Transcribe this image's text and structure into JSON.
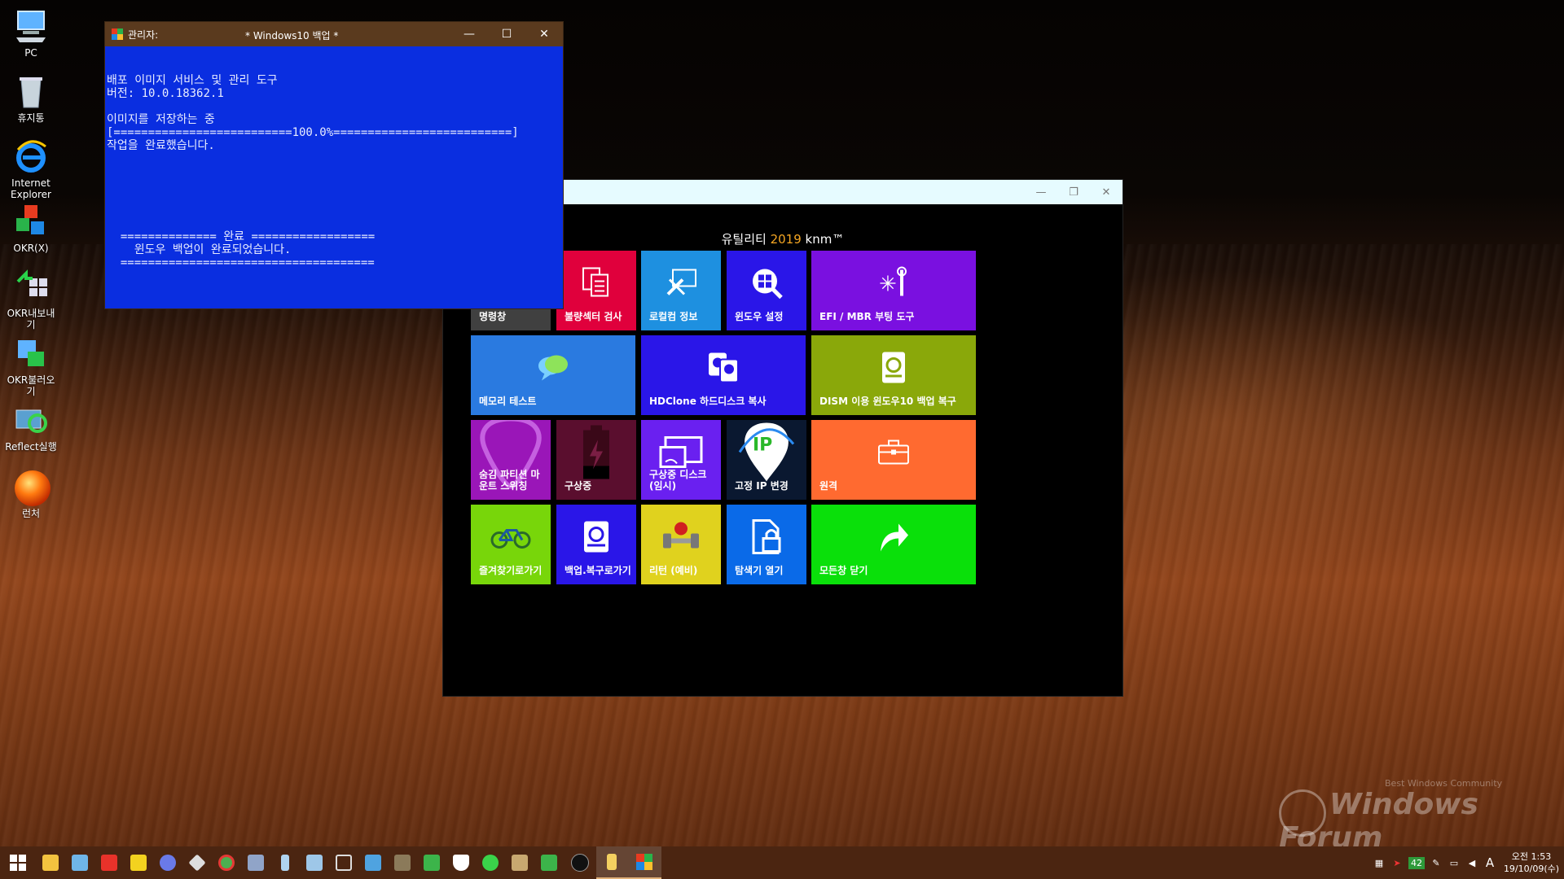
{
  "desktop": {
    "icons": [
      {
        "label": "PC",
        "icon": "pc-icon"
      },
      {
        "label": "휴지통",
        "icon": "recycle-bin-icon"
      },
      {
        "label": "Internet Explorer",
        "icon": "ie-icon"
      },
      {
        "label": "OKR(X)",
        "icon": "okr-icon"
      },
      {
        "label": "OKR내보내기",
        "icon": "okr-export-icon"
      },
      {
        "label": "OKR불러오기",
        "icon": "okr-import-icon"
      },
      {
        "label": "Reflect실행",
        "icon": "reflect-icon"
      },
      {
        "label": "런처",
        "icon": "launcher-icon"
      }
    ]
  },
  "cmd_window": {
    "title_prefix": "관리자:",
    "title": "* Windows10 백업 *",
    "lines": [
      "",
      "배포 이미지 서비스 및 관리 도구",
      "버전: 10.0.18362.1",
      "",
      "이미지를 저장하는 중",
      "[==========================100.0%==========================]",
      "작업을 완료했습니다.",
      "",
      "",
      "",
      "",
      "",
      "",
      "  ============== 완료 ==================",
      "    윈도우 백업이 완료되었습니다.",
      "  ====================================="
    ]
  },
  "util_window": {
    "heading_pre": "유틸리티 ",
    "heading_year": "2019",
    "heading_post": " knm™",
    "tiles": [
      {
        "label": "명령창",
        "color": "#404040",
        "icon": "cmd-icon"
      },
      {
        "label": "불량섹터 검사",
        "color": "#e0003c",
        "icon": "documents-icon"
      },
      {
        "label": "로컬컴 정보",
        "color": "#1e90e0",
        "icon": "tools-icon"
      },
      {
        "label": "윈도우 설정",
        "color": "#2a16e8",
        "icon": "windows-search-icon"
      },
      {
        "label": "EFI / MBR 부팅 도구",
        "color": "#7a10e0",
        "icon": "wrench-icon"
      },
      {
        "label": "메모리 테스트",
        "color": "#2a7ae0",
        "icon": "chat-icon"
      },
      {
        "label": "HDClone 하드디스크 복사",
        "color": "#2a16e8",
        "icon": "disk-copy-icon"
      },
      {
        "label": "DISM 이용 윈도우10 백업 복구",
        "color": "#8aa80a",
        "icon": "drive-restore-icon"
      },
      {
        "label": "숨김 파티션 마운트 스위칭",
        "color": "#9a16b8",
        "icon": "pick-icon"
      },
      {
        "label": "구상중",
        "color": "#5a0e2e",
        "icon": "battery-icon"
      },
      {
        "label": "구상중 디스크 (임시)",
        "color": "#6a20f0",
        "icon": "cast-icon"
      },
      {
        "label": "고정 IP 변경",
        "color": "#0a1830",
        "icon": "ip-pin-icon"
      },
      {
        "label": "원격",
        "color": "#ff6a30",
        "icon": "briefcase-icon"
      },
      {
        "label": "즐겨찾기로가기",
        "color": "#78d60a",
        "icon": "bicycle-icon"
      },
      {
        "label": "백업.복구로가기",
        "color": "#2a16e8",
        "icon": "backup-drive-icon"
      },
      {
        "label": "리턴 (예비)",
        "color": "#e0d21e",
        "icon": "dumbbell-icon"
      },
      {
        "label": "탐색기 열기",
        "color": "#0a6ae8",
        "icon": "lock-file-icon"
      },
      {
        "label": "모든창 닫기",
        "color": "#0ae00a",
        "icon": "share-arrow-icon"
      }
    ]
  },
  "watermark": {
    "text": "Windows Forum",
    "sub": "Best Windows Community"
  },
  "taskbar": {
    "tray_badge": "42",
    "ime": "A",
    "time": "오전 1:53",
    "date": "19/10/09(수)"
  }
}
